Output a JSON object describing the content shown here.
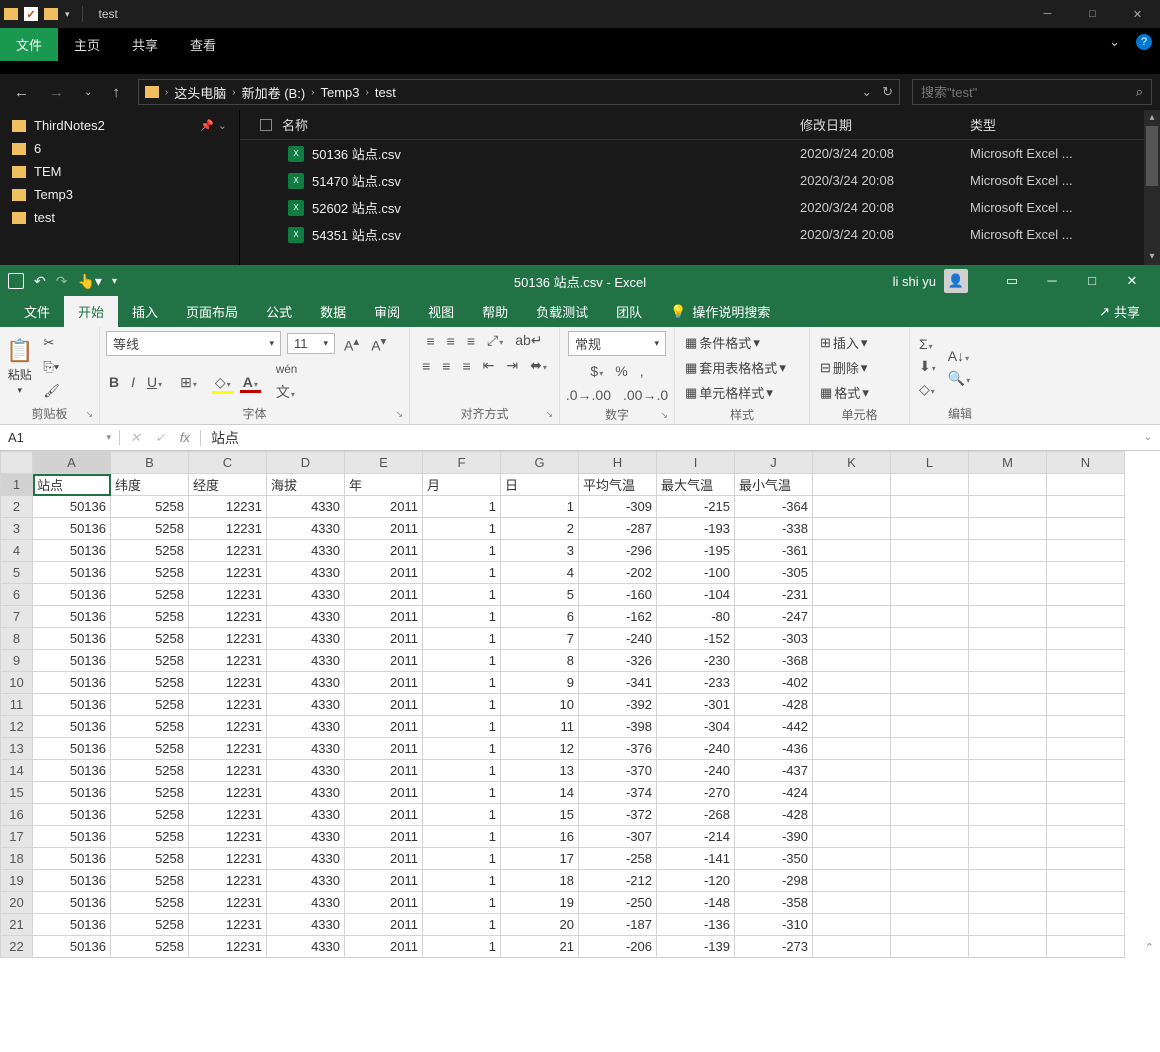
{
  "explorer": {
    "title": "test",
    "tabs": {
      "file": "文件",
      "home": "主页",
      "share": "共享",
      "view": "查看"
    },
    "breadcrumb": [
      "这头电脑",
      "新加卷 (B:)",
      "Temp3",
      "test"
    ],
    "search_placeholder": "搜索\"test\"",
    "tree": [
      {
        "name": "ThirdNotes2",
        "pinned": true
      },
      {
        "name": "6"
      },
      {
        "name": "TEM"
      },
      {
        "name": "Temp3"
      },
      {
        "name": "test"
      }
    ],
    "headers": {
      "name": "名称",
      "date": "修改日期",
      "type": "类型"
    },
    "files": [
      {
        "name": "50136 站点.csv",
        "date": "2020/3/24 20:08",
        "type": "Microsoft Excel ..."
      },
      {
        "name": "51470 站点.csv",
        "date": "2020/3/24 20:08",
        "type": "Microsoft Excel ..."
      },
      {
        "name": "52602 站点.csv",
        "date": "2020/3/24 20:08",
        "type": "Microsoft Excel ..."
      },
      {
        "name": "54351 站点.csv",
        "date": "2020/3/24 20:08",
        "type": "Microsoft Excel ..."
      }
    ]
  },
  "excel": {
    "title": "50136 站点.csv  -  Excel",
    "user": "li shi yu",
    "tabs": [
      "文件",
      "开始",
      "插入",
      "页面布局",
      "公式",
      "数据",
      "审阅",
      "视图",
      "帮助",
      "负载测试",
      "团队"
    ],
    "active_tab": "开始",
    "tell_me": "操作说明搜索",
    "share": "共享",
    "ribbon": {
      "clipboard": "剪贴板",
      "paste": "粘贴",
      "font": "字体",
      "font_name": "等线",
      "font_size": "11",
      "alignment": "对齐方式",
      "number": "数字",
      "number_fmt": "常规",
      "styles": "样式",
      "cond_fmt": "条件格式",
      "table_fmt": "套用表格格式",
      "cell_styles": "单元格样式",
      "cells": "单元格",
      "insert": "插入",
      "delete": "删除",
      "format": "格式",
      "editing": "编辑"
    },
    "namebox": "A1",
    "formula_value": "站点",
    "columns": [
      "A",
      "B",
      "C",
      "D",
      "E",
      "F",
      "G",
      "H",
      "I",
      "J",
      "K",
      "L",
      "M",
      "N"
    ],
    "header_row": [
      "站点",
      "纬度",
      "经度",
      "海拔",
      "年",
      "月",
      "日",
      "平均气温",
      "最大气温",
      "最小气温",
      "",
      "",
      "",
      ""
    ],
    "rows": [
      [
        50136,
        5258,
        12231,
        4330,
        2011,
        1,
        1,
        -309,
        -215,
        -364
      ],
      [
        50136,
        5258,
        12231,
        4330,
        2011,
        1,
        2,
        -287,
        -193,
        -338
      ],
      [
        50136,
        5258,
        12231,
        4330,
        2011,
        1,
        3,
        -296,
        -195,
        -361
      ],
      [
        50136,
        5258,
        12231,
        4330,
        2011,
        1,
        4,
        -202,
        -100,
        -305
      ],
      [
        50136,
        5258,
        12231,
        4330,
        2011,
        1,
        5,
        -160,
        -104,
        -231
      ],
      [
        50136,
        5258,
        12231,
        4330,
        2011,
        1,
        6,
        -162,
        -80,
        -247
      ],
      [
        50136,
        5258,
        12231,
        4330,
        2011,
        1,
        7,
        -240,
        -152,
        -303
      ],
      [
        50136,
        5258,
        12231,
        4330,
        2011,
        1,
        8,
        -326,
        -230,
        -368
      ],
      [
        50136,
        5258,
        12231,
        4330,
        2011,
        1,
        9,
        -341,
        -233,
        -402
      ],
      [
        50136,
        5258,
        12231,
        4330,
        2011,
        1,
        10,
        -392,
        -301,
        -428
      ],
      [
        50136,
        5258,
        12231,
        4330,
        2011,
        1,
        11,
        -398,
        -304,
        -442
      ],
      [
        50136,
        5258,
        12231,
        4330,
        2011,
        1,
        12,
        -376,
        -240,
        -436
      ],
      [
        50136,
        5258,
        12231,
        4330,
        2011,
        1,
        13,
        -370,
        -240,
        -437
      ],
      [
        50136,
        5258,
        12231,
        4330,
        2011,
        1,
        14,
        -374,
        -270,
        -424
      ],
      [
        50136,
        5258,
        12231,
        4330,
        2011,
        1,
        15,
        -372,
        -268,
        -428
      ],
      [
        50136,
        5258,
        12231,
        4330,
        2011,
        1,
        16,
        -307,
        -214,
        -390
      ],
      [
        50136,
        5258,
        12231,
        4330,
        2011,
        1,
        17,
        -258,
        -141,
        -350
      ],
      [
        50136,
        5258,
        12231,
        4330,
        2011,
        1,
        18,
        -212,
        -120,
        -298
      ],
      [
        50136,
        5258,
        12231,
        4330,
        2011,
        1,
        19,
        -250,
        -148,
        -358
      ],
      [
        50136,
        5258,
        12231,
        4330,
        2011,
        1,
        20,
        -187,
        -136,
        -310
      ],
      [
        50136,
        5258,
        12231,
        4330,
        2011,
        1,
        21,
        -206,
        -139,
        -273
      ]
    ]
  }
}
